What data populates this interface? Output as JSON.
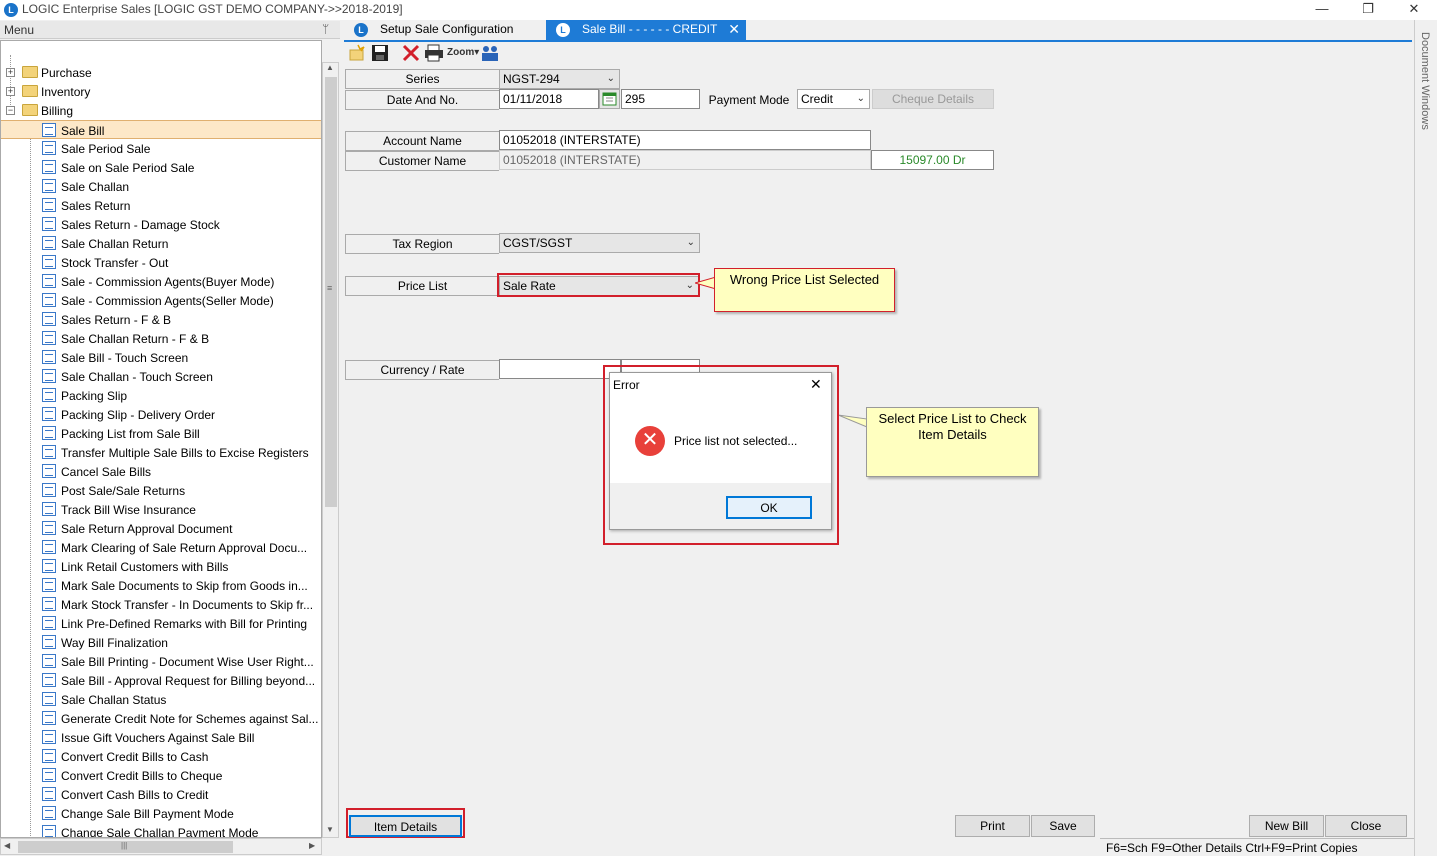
{
  "window": {
    "title": "LOGIC Enterprise Sales  [LOGIC GST DEMO COMPANY->>2018-2019]",
    "minimize": "—",
    "restore": "❐",
    "close": "✕"
  },
  "menu": {
    "header": "Menu",
    "pin": "ᛘ",
    "top_items": [
      {
        "label": "Purchase",
        "expander": "+"
      },
      {
        "label": "Inventory",
        "expander": "+"
      },
      {
        "label": "Billing",
        "expander": "−"
      }
    ],
    "billing_items": [
      "Sale Bill",
      "Sale Period Sale",
      "Sale on Sale Period Sale",
      "Sale Challan",
      "Sales Return",
      "Sales Return - Damage Stock",
      "Sale Challan Return",
      "Stock Transfer - Out",
      "Sale - Commission Agents(Buyer Mode)",
      "Sale - Commission Agents(Seller Mode)",
      "Sales Return - F & B",
      "Sale Challan Return - F & B",
      "Sale Bill - Touch Screen",
      "Sale Challan - Touch Screen",
      "Packing Slip",
      "Packing Slip - Delivery Order",
      "Packing List from Sale Bill",
      "Transfer Multiple Sale Bills to Excise Registers",
      "Cancel Sale Bills",
      "Post Sale/Sale Returns",
      "Track Bill Wise Insurance",
      "Sale Return Approval Document",
      "Mark Clearing of Sale Return Approval Docu...",
      "Link Retail Customers with Bills",
      "Mark Sale Documents to Skip from Goods in...",
      "Mark Stock Transfer - In Documents to Skip fr...",
      "Link Pre-Defined Remarks with Bill for Printing",
      "Way Bill Finalization",
      "Sale Bill Printing - Document Wise User Right...",
      "Sale Bill - Approval Request for Billing beyond...",
      "Sale Challan Status",
      "Generate Credit Note for Schemes against Sal...",
      "Issue Gift Vouchers Against Sale Bill",
      "Convert Credit Bills to Cash",
      "Convert Credit Bills to Cheque",
      "Convert Cash Bills to Credit",
      "Change Sale Bill Payment Mode",
      "Change Sale Challan Payment Mode"
    ],
    "selected_index": 0,
    "scroll_up": "▲",
    "scroll_down": "▼",
    "scroll_grip": "≡",
    "hscroll_left": "◀",
    "hscroll_right": "▶",
    "hscroll_grip": "|||"
  },
  "tabs": [
    {
      "label": "Setup Sale Configuration",
      "active": false
    },
    {
      "label": "Sale Bill -  - - - -  - CREDIT",
      "active": true,
      "close": "✕"
    }
  ],
  "toolbar": {
    "zoom_label": "Zoom▾"
  },
  "form": {
    "series_label": "Series",
    "series_value": "NGST-294",
    "date_label": "Date And No.",
    "date_value": "01/11/2018",
    "number_value": "295",
    "payment_mode_label": "Payment Mode",
    "payment_mode_value": "Credit",
    "cheque_details_label": "Cheque Details",
    "account_name_label": "Account Name",
    "account_name_value": "01052018 (INTERSTATE)",
    "customer_name_label": "Customer Name",
    "customer_name_value": "01052018 (INTERSTATE)",
    "balance_value": "15097.00 Dr",
    "tax_region_label": "Tax Region",
    "tax_region_value": "CGST/SGST",
    "price_list_label": "Price List",
    "price_list_value": "Sale Rate",
    "currency_label": "Currency / Rate",
    "currency_value": "",
    "rate_value": ""
  },
  "callouts": {
    "wrong_price_list": "Wrong Price List Selected",
    "select_price_list": "Select Price List to Check Item Details"
  },
  "dialog": {
    "title": "Error",
    "close": "✕",
    "icon": "✕",
    "message": "Price list not selected...",
    "ok_label": "OK"
  },
  "buttons": {
    "item_details": "Item Details",
    "print": "Print",
    "save": "Save",
    "new_bill": "New Bill",
    "close": "Close"
  },
  "side_panel": {
    "label": "Document Windows"
  },
  "status_bar": {
    "text": "F6=Sch  F9=Other Details  Ctrl+F9=Print Copies"
  },
  "colors": {
    "accent": "#1e7bd6",
    "highlight_red": "#d21f2b",
    "callout_bg": "#ffffc0",
    "balance_green": "#2a8a2a",
    "selected_row": "#fde8c8"
  }
}
